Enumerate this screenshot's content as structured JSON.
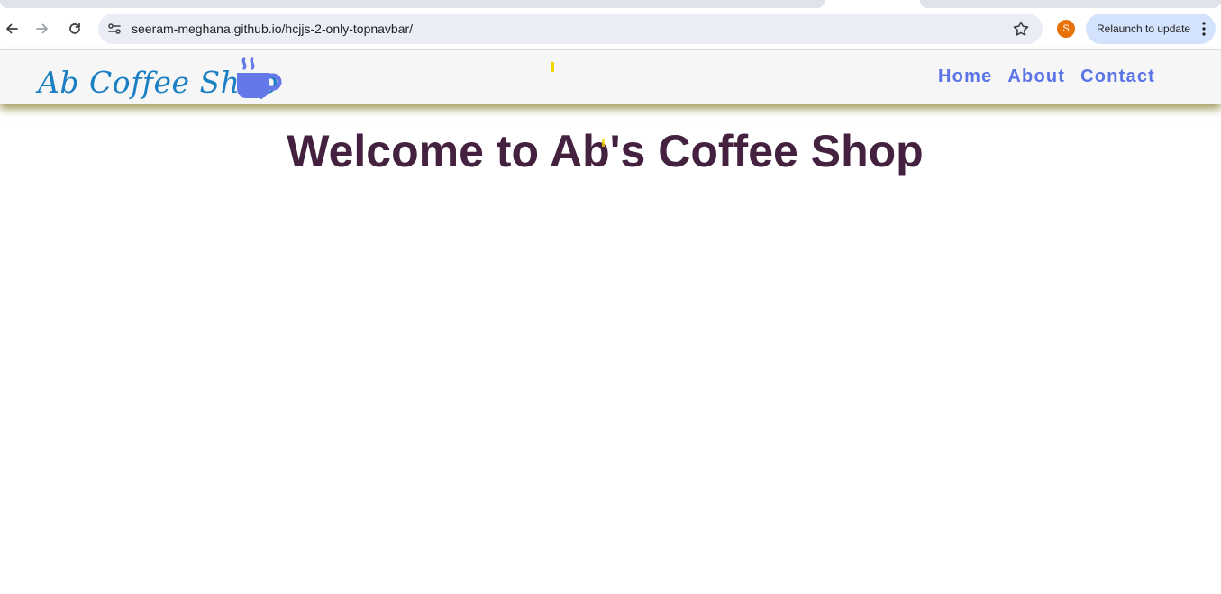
{
  "browser": {
    "url": "seeram-meghana.github.io/hcjjs-2-only-topnavbar/",
    "profile_initial": "S",
    "relaunch_label": "Relaunch to update",
    "colors": {
      "omnibox_bg": "#eaedf6",
      "relaunch_bg": "#d3e3fd",
      "avatar_bg": "#e8710a"
    }
  },
  "navbar": {
    "brand": "Ab Coffee Shop",
    "brand_icon": "coffee-cup-icon",
    "links": [
      {
        "label": "Home"
      },
      {
        "label": "About"
      },
      {
        "label": "Contact"
      }
    ],
    "colors": {
      "brand": "#1b7fc4",
      "link": "#5b74e6",
      "background": "#f6f6f6",
      "shadow": "#827a28"
    }
  },
  "main": {
    "title": "Welcome to Ab's Coffee Shop",
    "title_color": "#43213f"
  }
}
